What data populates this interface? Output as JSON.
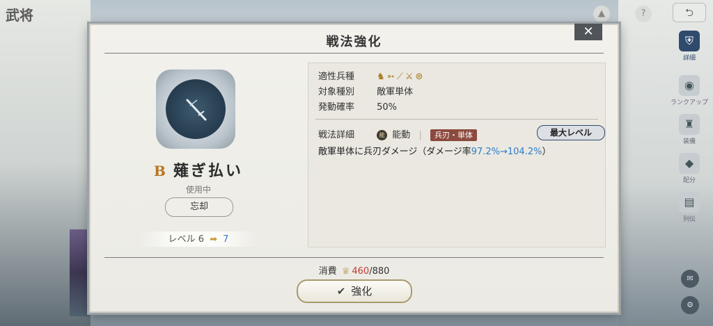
{
  "background": {
    "title": "武将",
    "side_nav": [
      {
        "label": "詳細",
        "icon": "armor-icon"
      },
      {
        "label": "ランクアップ",
        "icon": "eye-icon"
      },
      {
        "label": "装備",
        "icon": "helmet-icon"
      },
      {
        "label": "配分",
        "icon": "gem-icon"
      },
      {
        "label": "列伝",
        "icon": "book-icon"
      }
    ]
  },
  "dialog": {
    "title": "戦法強化",
    "close_label": "✕",
    "skill": {
      "grade": "B",
      "name": "薙ぎ払い",
      "status": "使用中",
      "forget_label": "忘却",
      "level_label": "レベル",
      "level_current": "6",
      "level_next": "7"
    },
    "props": {
      "unit_types_label": "適性兵種",
      "target_label": "対象種別",
      "target_value": "敵軍単体",
      "chance_label": "発動確率",
      "chance_value": "50%"
    },
    "detail": {
      "label": "戦法詳細",
      "badge": "能",
      "type": "能動",
      "tag": "兵刃・単体",
      "max_level": "最大レベル",
      "desc_prefix": "敵軍単体に兵刃ダメージ（ダメージ率",
      "desc_value": "97.2%→104.2%",
      "desc_suffix": "）"
    },
    "cost": {
      "label": "消費",
      "current": "460",
      "total": "/880"
    },
    "enhance_label": "強化"
  },
  "colors": {
    "accent_gold": "#a7791d",
    "value_blue": "#2f7cc9",
    "cost_red": "#c23b32",
    "tag_red": "#8c4a3e",
    "nav_active": "#2f4a6c"
  }
}
